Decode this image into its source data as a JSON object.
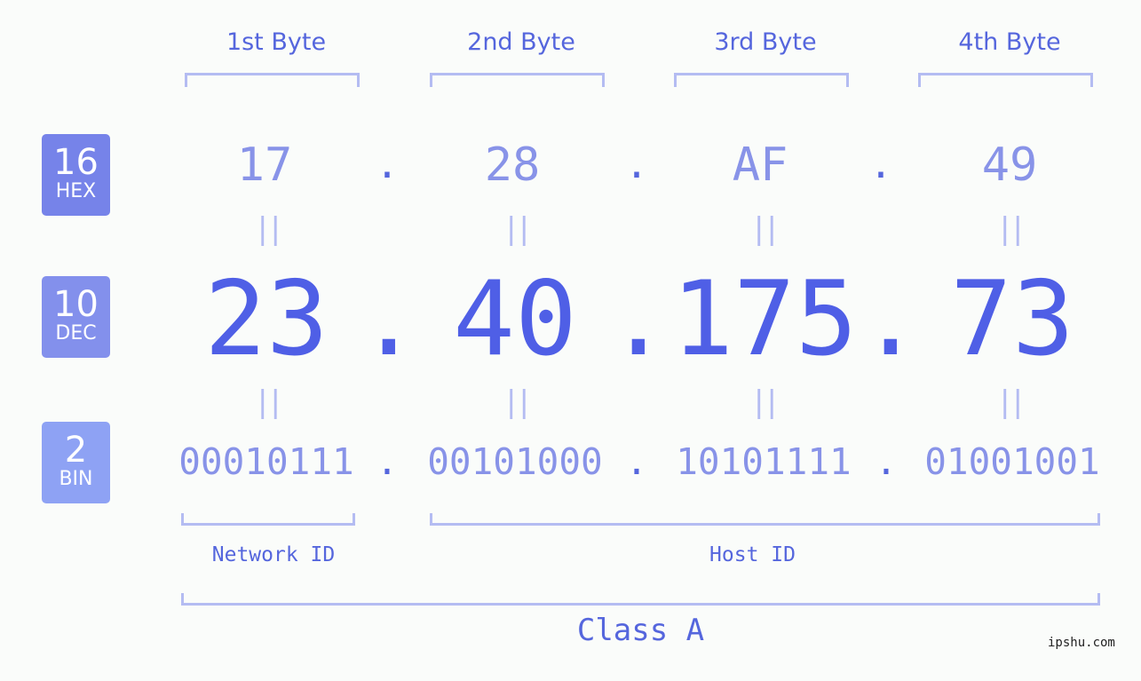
{
  "bytes": [
    {
      "label": "1st Byte",
      "hex": "17",
      "dec": "23",
      "bin": "00010111"
    },
    {
      "label": "2nd Byte",
      "hex": "28",
      "dec": "40",
      "bin": "00101000"
    },
    {
      "label": "3rd Byte",
      "hex": "AF",
      "dec": "175",
      "bin": "10101111"
    },
    {
      "label": "4th Byte",
      "hex": "49",
      "dec": "73",
      "bin": "01001001"
    }
  ],
  "separator": ".",
  "equals": "||",
  "badges": {
    "hex": {
      "num": "16",
      "label": "HEX",
      "color": "#7683e9"
    },
    "dec": {
      "num": "10",
      "label": "DEC",
      "color": "#8390ec"
    },
    "bin": {
      "num": "2",
      "label": "BIN",
      "color": "#8ea2f4"
    }
  },
  "network_id_label": "Network ID",
  "host_id_label": "Host ID",
  "class_label": "Class A",
  "watermark": "ipshu.com"
}
